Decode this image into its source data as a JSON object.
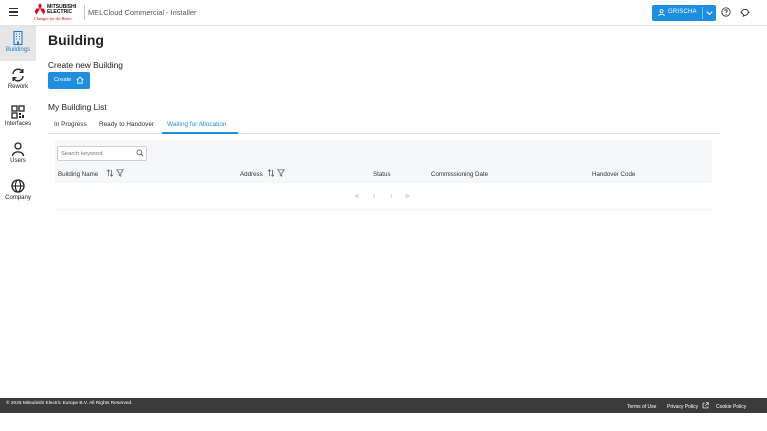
{
  "header": {
    "logo_brand_line1": "MITSUBISHI",
    "logo_brand_line2": "ELECTRIC",
    "logo_tagline": "Changes for the Better",
    "app_title": "MELCloud Commercial - Installer",
    "user_label": "GRISCHA"
  },
  "sidebar": {
    "items": [
      {
        "label": "Buildings",
        "icon": "building-icon",
        "active": true
      },
      {
        "label": "Rework",
        "icon": "refresh-icon",
        "active": false
      },
      {
        "label": "Interfaces",
        "icon": "qr-code-icon",
        "active": false
      },
      {
        "label": "Users",
        "icon": "user-icon",
        "active": false
      },
      {
        "label": "Company",
        "icon": "globe-icon",
        "active": false
      }
    ]
  },
  "main": {
    "title": "Building",
    "create_heading": "Create new Building",
    "create_button": "Create",
    "list_heading": "My Building List",
    "tabs": [
      {
        "label": "In Progress",
        "active": false
      },
      {
        "label": "Ready to Handover",
        "active": false
      },
      {
        "label": "Waiting for Allocation",
        "active": true
      }
    ],
    "search": {
      "placeholder": "Search keyword",
      "value": ""
    },
    "columns": [
      "Building Name",
      "Address",
      "Status",
      "Commissioning Date",
      "Handover Code"
    ],
    "rows": [],
    "pager": {
      "first": "«",
      "prev": "‹",
      "next": "›",
      "last": "»"
    }
  },
  "footer": {
    "copyright": "© 2025 Mitsubishi Electric Europe B.V. All Rights Reserved.",
    "terms": "Terms of Use",
    "privacy": "Privacy Policy",
    "cookie": "Cookie Policy"
  },
  "colors": {
    "accent": "#1e8fe0",
    "brand_red": "#e60012",
    "footer_bg": "#3b3b3b",
    "sidebar_active_bg": "#e6e6e6"
  }
}
